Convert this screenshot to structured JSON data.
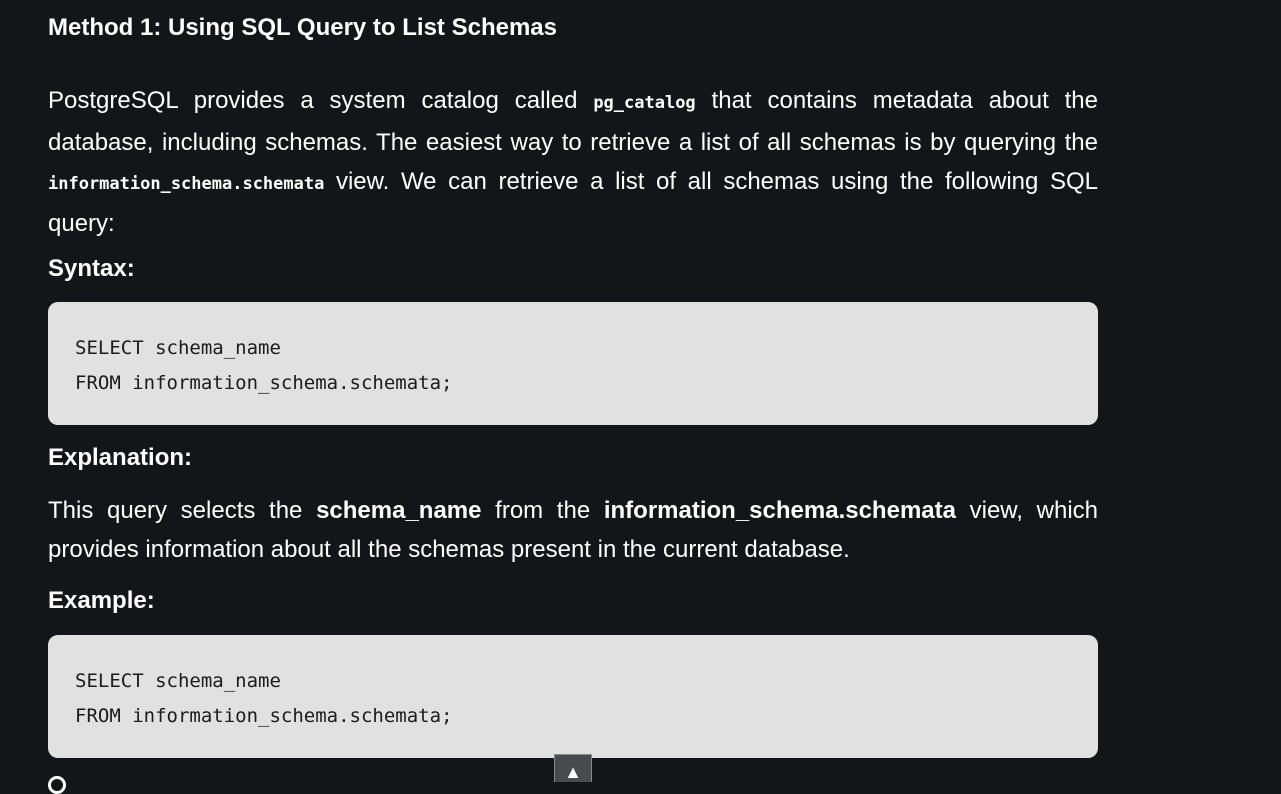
{
  "article": {
    "heading": "Method 1: Using SQL Query to List Schemas",
    "intro": {
      "t1": "PostgreSQL provides a system catalog called ",
      "c1": "pg_catalog",
      "t2": " that contains metadata about the database, including schemas. The easiest way to retrieve a list of all schemas is by querying the ",
      "c2": "information_schema.schemata",
      "t3": " view. We can retrieve a list of all schemas using the following SQL query:"
    },
    "syntax_label": "Syntax:",
    "syntax_code": [
      "SELECT schema_name",
      "FROM information_schema.schemata;"
    ],
    "explanation_label": "Explanation:",
    "explanation": {
      "t1": "This query selects the ",
      "b1": "schema_name",
      "t2": " from the ",
      "b2": "information_schema.schemata",
      "t3": " view, which provides information about all the schemas present in the current database."
    },
    "example_label": "Example:",
    "example_code": [
      "SELECT schema_name",
      "FROM information_schema.schemata;"
    ]
  },
  "scroll_top": {
    "glyph": "▲",
    "icon": "arrow-up-icon"
  }
}
